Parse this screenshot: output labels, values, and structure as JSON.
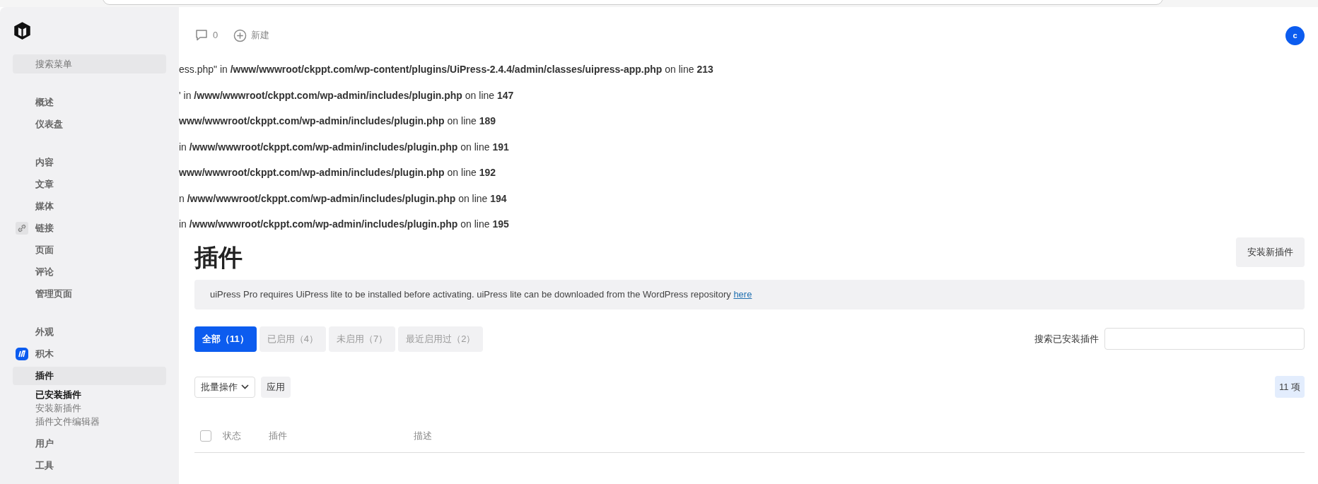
{
  "sidebar": {
    "search": {
      "placeholder": "搜索菜单"
    },
    "groups": [
      [
        {
          "label": "概述",
          "selected": false
        },
        {
          "label": "仪表盘",
          "selected": false
        }
      ],
      [
        {
          "label": "内容",
          "selected": false
        },
        {
          "label": "文章",
          "selected": false
        },
        {
          "label": "媒体",
          "selected": false
        },
        {
          "label": "链接",
          "selected": false,
          "kind": "link"
        },
        {
          "label": "页面",
          "selected": false
        },
        {
          "label": "评论",
          "selected": false
        },
        {
          "label": "管理页面",
          "selected": false
        }
      ],
      [
        {
          "label": "外观",
          "selected": false
        },
        {
          "label": "积木",
          "selected": false,
          "kind": "brand"
        },
        {
          "label": "插件",
          "selected": true,
          "children": [
            {
              "label": "已安装插件",
              "selected": true
            },
            {
              "label": "安装新插件",
              "selected": false
            },
            {
              "label": "插件文件编辑器",
              "selected": false
            }
          ]
        },
        {
          "label": "用户",
          "selected": false
        },
        {
          "label": "工具",
          "selected": false
        }
      ]
    ]
  },
  "toolbar": {
    "comments": "0",
    "new": "新建",
    "avatar": "c"
  },
  "errors": [
    "ess.php\" in **/www/wwwroot/ckppt.com/wp-content/plugins/UiPress-2.4.4/admin/classes/uipress-app.php** on line **213**",
    "' in **/www/wwwroot/ckppt.com/wp-admin/includes/plugin.php** on line **147**",
    "**www/wwwroot/ckppt.com/wp-admin/includes/plugin.php** on line **189**",
    " in **/www/wwwroot/ckppt.com/wp-admin/includes/plugin.php** on line **191**",
    "**www/wwwroot/ckppt.com/wp-admin/includes/plugin.php** on line **192**",
    "n **/www/wwwroot/ckppt.com/wp-admin/includes/plugin.php** on line **194**",
    "in **/www/wwwroot/ckppt.com/wp-admin/includes/plugin.php** on line **195**"
  ],
  "page": {
    "title": "插件",
    "add_button": "安装新插件"
  },
  "notice": {
    "text": "uiPress Pro requires UiPress lite to be installed before activating. uiPress lite can be downloaded from the WordPress repository",
    "link": "here"
  },
  "filters": [
    {
      "label": "全部（11）",
      "selected": true
    },
    {
      "label": "已启用（4）",
      "selected": false
    },
    {
      "label": "未启用（7）",
      "selected": false
    },
    {
      "label": "最近启用过（2）",
      "selected": false
    }
  ],
  "search": {
    "label": "搜索已安装插件"
  },
  "bulk": {
    "select": "批量操作",
    "apply": "应用",
    "count": "11 项"
  },
  "table": {
    "select_all": {
      "checked": false
    },
    "columns": [
      "状态",
      "插件",
      "描述"
    ]
  }
}
